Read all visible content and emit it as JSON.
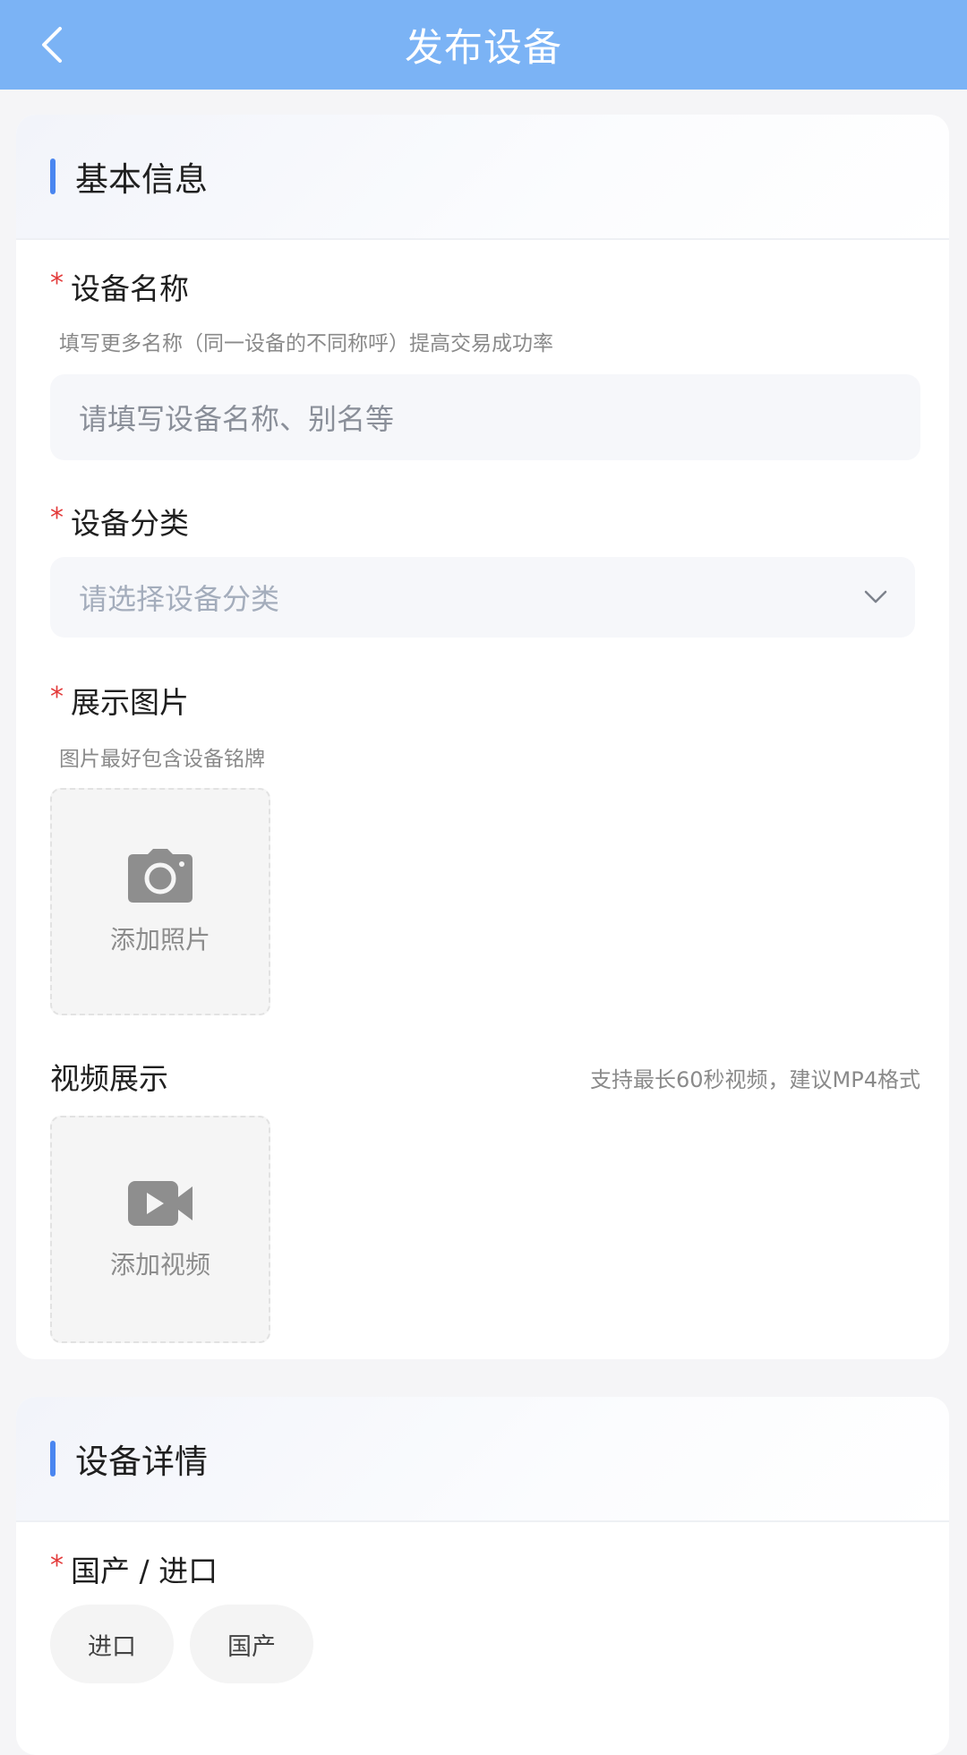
{
  "header": {
    "title": "发布设备",
    "back_icon": "chevron-left-icon"
  },
  "basic_info": {
    "section_title": "基本信息",
    "device_name": {
      "label": "设备名称",
      "required_mark": "*",
      "hint": "填写更多名称（同一设备的不同称呼）提高交易成功率",
      "placeholder": "请填写设备名称、别名等"
    },
    "category": {
      "label": "设备分类",
      "required_mark": "*",
      "placeholder": "请选择设备分类",
      "icon": "chevron-down-icon"
    },
    "images": {
      "label": "展示图片",
      "required_mark": "*",
      "hint": "图片最好包含设备铭牌",
      "add_label": "添加照片",
      "icon": "camera-icon"
    },
    "video": {
      "label": "视频展示",
      "hint": "支持最长60秒视频，建议MP4格式",
      "add_label": "添加视频",
      "icon": "video-camera-icon"
    }
  },
  "device_details": {
    "section_title": "设备详情",
    "origin": {
      "label": "国产 / 进口",
      "required_mark": "*",
      "options": [
        "进口",
        "国产"
      ]
    }
  },
  "colors": {
    "header_bg": "#7bb3f5",
    "accent": "#4a86f0",
    "required": "#e33a3a"
  }
}
